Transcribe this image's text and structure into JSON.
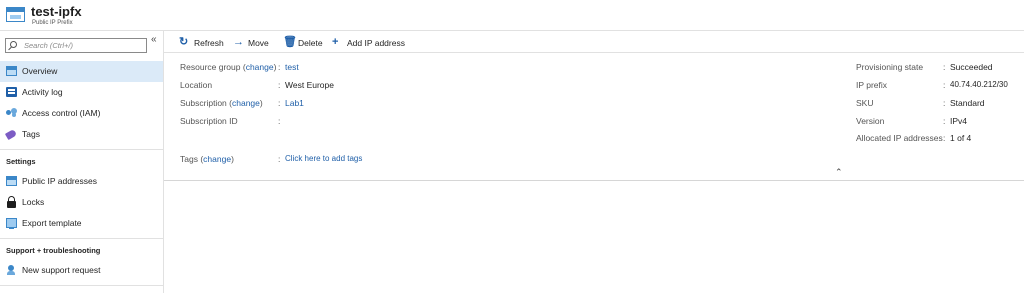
{
  "header": {
    "title": "test-ipfx",
    "subtitle": "Public IP Prefix"
  },
  "sidebar": {
    "search_placeholder": "Search (Ctrl+/)",
    "collapse_glyph": "«",
    "items": [
      {
        "label": "Overview",
        "icon": "overview-icon"
      },
      {
        "label": "Activity log",
        "icon": "activity-log-icon"
      },
      {
        "label": "Access control (IAM)",
        "icon": "iam-icon"
      },
      {
        "label": "Tags",
        "icon": "tag-icon"
      }
    ],
    "settings_heading": "Settings",
    "settings_items": [
      {
        "label": "Public IP addresses",
        "icon": "public-ip-icon"
      },
      {
        "label": "Locks",
        "icon": "lock-icon"
      },
      {
        "label": "Export template",
        "icon": "export-template-icon"
      }
    ],
    "support_heading": "Support + troubleshooting",
    "support_items": [
      {
        "label": "New support request",
        "icon": "support-icon"
      }
    ]
  },
  "toolbar": {
    "refresh": "Refresh",
    "move": "Move",
    "delete": "Delete",
    "add_ip": "Add IP address"
  },
  "essentials": {
    "left": {
      "resource_group_label": "Resource group",
      "change": "change",
      "resource_group_value": "test",
      "location_label": "Location",
      "location_value": "West Europe",
      "subscription_label": "Subscription",
      "subscription_value": "Lab1",
      "subscription_id_label": "Subscription ID",
      "subscription_id_value": "",
      "tags_label": "Tags",
      "tags_value": "Click here to add tags"
    },
    "right": {
      "provisioning_label": "Provisioning state",
      "provisioning_value": "Succeeded",
      "prefix_label": "IP prefix",
      "prefix_value": "40.74.40.212/30",
      "sku_label": "SKU",
      "sku_value": "Standard",
      "version_label": "Version",
      "version_value": "IPv4",
      "allocated_label": "Allocated IP addresses",
      "allocated_value": "1 of 4"
    },
    "collapse_glyph": "⌃"
  },
  "colors": {
    "accent": "#1f5fa8",
    "active_bg": "#dbeaf8",
    "border": "#e1e1e1"
  }
}
